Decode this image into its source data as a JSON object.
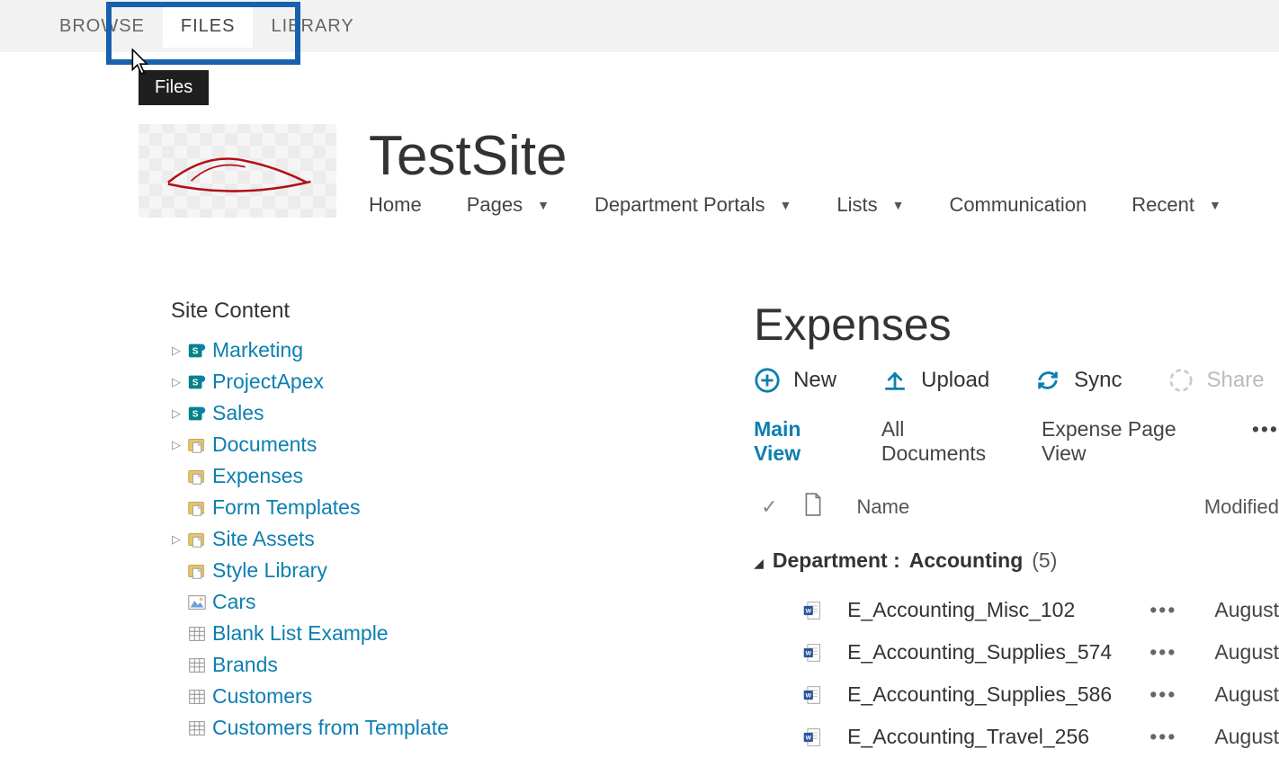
{
  "ribbon": {
    "tabs": [
      "BROWSE",
      "FILES",
      "LIBRARY"
    ],
    "active": "FILES",
    "tooltip": "Files"
  },
  "site": {
    "title": "TestSite",
    "nav": [
      {
        "label": "Home",
        "has_menu": false
      },
      {
        "label": "Pages",
        "has_menu": true
      },
      {
        "label": "Department Portals",
        "has_menu": true
      },
      {
        "label": "Lists",
        "has_menu": true
      },
      {
        "label": "Communication",
        "has_menu": false
      },
      {
        "label": "Recent",
        "has_menu": true
      }
    ]
  },
  "sidebar": {
    "title": "Site Content",
    "items": [
      {
        "label": "Marketing",
        "icon": "sp-site",
        "expandable": true
      },
      {
        "label": "ProjectApex",
        "icon": "sp-site",
        "expandable": true
      },
      {
        "label": "Sales",
        "icon": "sp-site",
        "expandable": true
      },
      {
        "label": "Documents",
        "icon": "doclib",
        "expandable": true
      },
      {
        "label": "Expenses",
        "icon": "doclib",
        "expandable": false
      },
      {
        "label": "Form Templates",
        "icon": "doclib",
        "expandable": false
      },
      {
        "label": "Site Assets",
        "icon": "doclib",
        "expandable": true
      },
      {
        "label": "Style Library",
        "icon": "doclib",
        "expandable": false
      },
      {
        "label": "Cars",
        "icon": "pic-lib",
        "expandable": false
      },
      {
        "label": "Blank List Example",
        "icon": "list",
        "expandable": false
      },
      {
        "label": "Brands",
        "icon": "list",
        "expandable": false
      },
      {
        "label": "Customers",
        "icon": "list",
        "expandable": false
      },
      {
        "label": "Customers from Template",
        "icon": "list",
        "expandable": false
      }
    ]
  },
  "library": {
    "title": "Expenses",
    "actions": {
      "new": "New",
      "upload": "Upload",
      "sync": "Sync",
      "share": "Share"
    },
    "views": [
      "Main View",
      "All Documents",
      "Expense Page View"
    ],
    "active_view": "Main View",
    "columns": {
      "check": "✓",
      "type": "",
      "name": "Name",
      "modified": "Modified"
    },
    "group": {
      "field": "Department",
      "value": "Accounting",
      "count": 5
    },
    "rows": [
      {
        "name": "E_Accounting_Misc_102",
        "modified": "August"
      },
      {
        "name": "E_Accounting_Supplies_574",
        "modified": "August"
      },
      {
        "name": "E_Accounting_Supplies_586",
        "modified": "August"
      },
      {
        "name": "E_Accounting_Travel_256",
        "modified": "August"
      }
    ]
  }
}
